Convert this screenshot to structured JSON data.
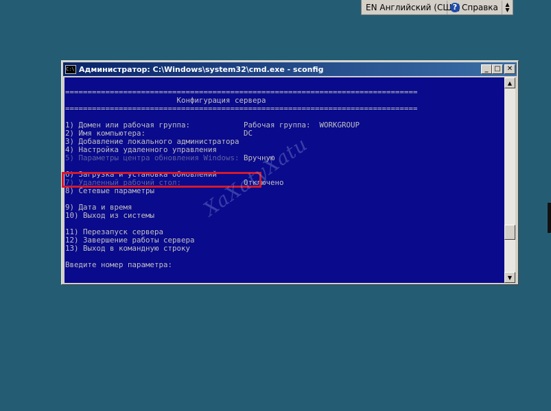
{
  "language_bar": {
    "language_label": "EN Английский (США)",
    "help_label": "Справка",
    "help_icon_glyph": "?"
  },
  "window": {
    "title": "Администратор: C:\\Windows\\system32\\cmd.exe - sconfig",
    "icon_text": "C:\\",
    "buttons": {
      "minimize": "_",
      "maximize": "□",
      "close": "✕"
    }
  },
  "console": {
    "separator": "===============================================================================",
    "header": "Конфигурация сервера",
    "menu": [
      {
        "label": "1) Домен или рабочая группа:",
        "value": "Рабочая группа:  WORKGROUP"
      },
      {
        "label": "2) Имя компьютера:",
        "value": "DC"
      },
      {
        "label": "3) Добавление локального администратора",
        "value": ""
      },
      {
        "label": "4) Настройка удаленного управления",
        "value": ""
      },
      {
        "label": "5) Параметры центра обновления Windows:",
        "value": "Вручную"
      },
      {
        "label": "6) Загрузка и установка обновлений",
        "value": ""
      },
      {
        "label": "7) Удаленный рабочий стол:",
        "value": "Отключено"
      },
      {
        "label": "8) Сетевые параметры",
        "value": ""
      },
      {
        "label": "9) Дата и время",
        "value": ""
      },
      {
        "label": "10) Выход из системы",
        "value": ""
      },
      {
        "label": "11) Перезапуск сервера",
        "value": ""
      },
      {
        "label": "12) Завершение работы сервера",
        "value": ""
      },
      {
        "label": "13) Выход в командную строку",
        "value": ""
      }
    ],
    "prompt": "Введите номер параметра:"
  },
  "watermark": "ХаХаtуХаtu",
  "colors": {
    "desktop": "#245d73",
    "console_bg": "#0a0a8c",
    "console_text": "#c0c0c0",
    "highlight": "#d6192b"
  }
}
